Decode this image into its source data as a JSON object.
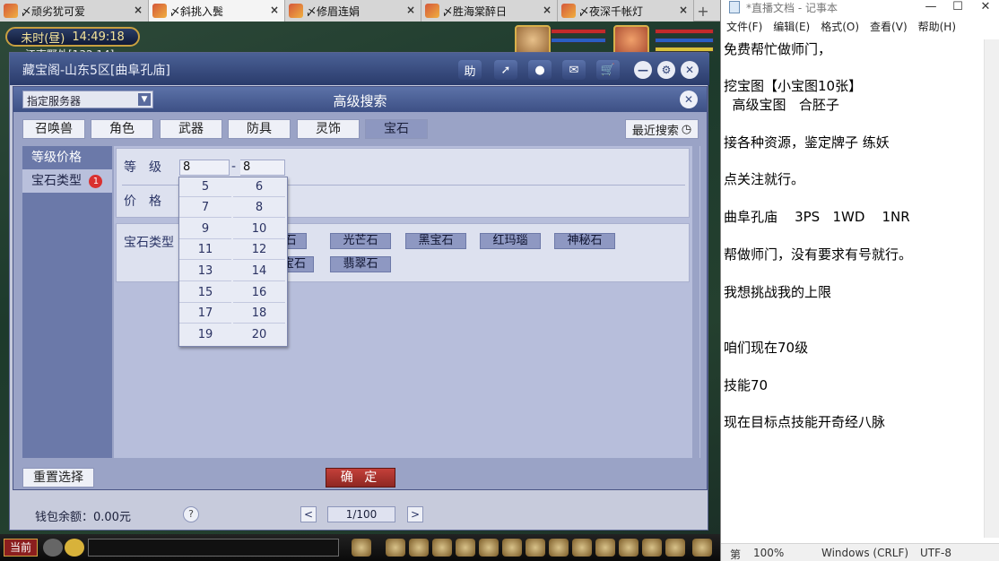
{
  "browser_tabs": [
    {
      "label": "〆顽劣犹可爱",
      "active": false
    },
    {
      "label": "〆斜挑入鬓",
      "active": true
    },
    {
      "label": "〆修眉连娟",
      "active": false
    },
    {
      "label": "〆胜海棠醉日",
      "active": false
    },
    {
      "label": "〆夜深千帐灯",
      "active": false
    }
  ],
  "tab_close_glyph": "×",
  "new_tab_glyph": "+",
  "game": {
    "time_period": "未时(昼)",
    "clock": "14:49:18",
    "location_coords": "江南野外[132,14]",
    "store_title": "藏宝阁-山东5区[曲阜孔庙]",
    "store_help_label": "助"
  },
  "search_dialog": {
    "server_select": "指定服务器",
    "title": "高级搜索",
    "categories": [
      "召唤兽",
      "角色",
      "武器",
      "防具",
      "灵饰",
      "宝石"
    ],
    "selected_category": "宝石",
    "recent_search": "最近搜索",
    "nav": [
      {
        "label": "等级价格",
        "badge": ""
      },
      {
        "label": "宝石类型",
        "badge": "1"
      }
    ],
    "level_label": "等　级",
    "level_min": "8",
    "level_separator": "-",
    "level_max": "8",
    "price_label": "价　格",
    "gem_type_label": "宝石类型",
    "gem_types": [
      "石",
      "光芒石",
      "黑宝石",
      "红玛瑙",
      "神秘石",
      "宝石",
      "翡翠石"
    ],
    "level_options": [
      "5",
      "6",
      "7",
      "8",
      "9",
      "10",
      "11",
      "12",
      "13",
      "14",
      "15",
      "16",
      "17",
      "18",
      "19",
      "20"
    ],
    "reset_button": "重置选择",
    "confirm_button": "确 定"
  },
  "store_footer": {
    "wallet": "钱包余额：0.00元",
    "help": "?",
    "page": "1/100",
    "prev": "<",
    "next": ">"
  },
  "bottom_bar": {
    "current_channel": "当前"
  },
  "notepad": {
    "title": "*直播文档 - 记事本",
    "menu": [
      "文件(F)",
      "编辑(E)",
      "格式(O)",
      "查看(V)",
      "帮助(H)"
    ],
    "lines": [
      "免费帮忙做师门，",
      "",
      "挖宝图【小宝图10张】",
      "  高级宝图   合胚子",
      "",
      "接各种资源，鉴定牌子 练妖",
      "",
      "点关注就行。",
      "",
      "曲阜孔庙    3PS   1WD    1NR",
      "",
      "帮做师门，没有要求有号就行。",
      "",
      "我想挑战我的上限",
      "",
      "",
      "咱们现在70级",
      "",
      "技能70",
      "",
      "现在目标点技能开奇经八脉"
    ],
    "status": {
      "line_col": "第",
      "zoom": "100%",
      "eol": "Windows (CRLF)",
      "encoding": "UTF-8"
    }
  },
  "colors": {
    "dialog_header": "#4b6196",
    "selected_tab": "#8d97c0",
    "confirm": "#b6362f",
    "badge": "#d93030"
  }
}
